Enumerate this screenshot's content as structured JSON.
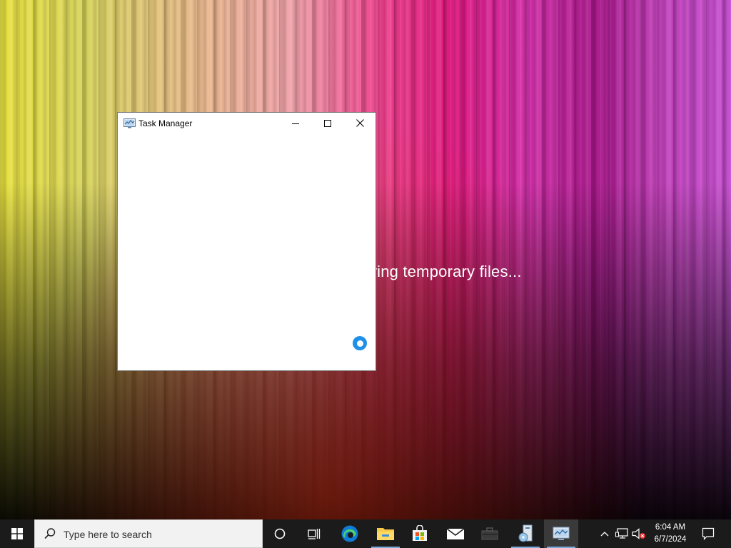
{
  "desktop": {
    "status_text": "Copying temporary files..."
  },
  "window": {
    "title": "Task Manager",
    "icon": "task-manager-icon",
    "state": "loading"
  },
  "taskbar": {
    "search_placeholder": "Type here to search",
    "apps": [
      {
        "name": "cortana",
        "icon": "circle-icon"
      },
      {
        "name": "task-view",
        "icon": "task-view-icon"
      },
      {
        "name": "edge",
        "icon": "edge-icon"
      },
      {
        "name": "file-explorer",
        "icon": "folder-icon",
        "open": true
      },
      {
        "name": "microsoft-store",
        "icon": "store-icon"
      },
      {
        "name": "mail",
        "icon": "mail-icon"
      },
      {
        "name": "toolbox",
        "icon": "toolbox-icon"
      },
      {
        "name": "media-setup",
        "icon": "media-icon",
        "open": true
      },
      {
        "name": "task-manager",
        "icon": "task-manager-icon",
        "active": true
      }
    ],
    "clock": {
      "time": "6:04 AM",
      "date": "6/7/2024"
    }
  },
  "colors": {
    "taskbar_bg": "#1b1b1b",
    "accent": "#1e90e8",
    "search_bg": "#f2f2f2"
  }
}
